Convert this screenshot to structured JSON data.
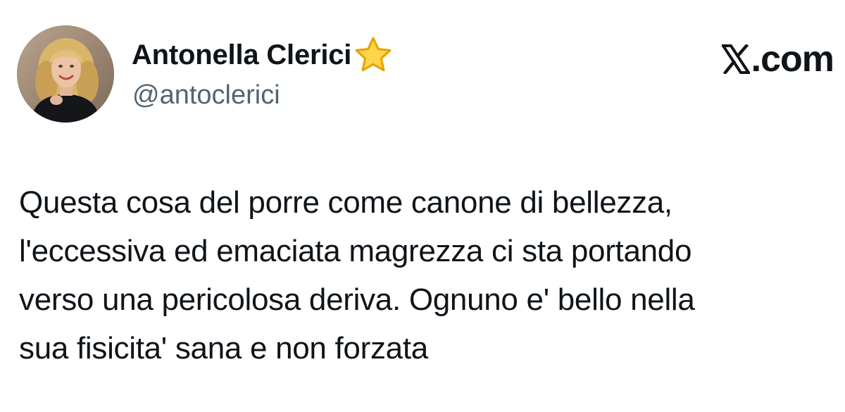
{
  "author": {
    "display_name": "Antonella Clerici",
    "badge_icon": "star-icon",
    "handle": "@antoclerici",
    "avatar_icon": "profile-photo"
  },
  "brand": {
    "logo_icon": "x-logo-icon",
    "text": ".com"
  },
  "tweet": {
    "lines": [
      "Questa cosa del porre come canone di bellezza,",
      "l'eccessiva ed emaciata magrezza ci sta portando",
      "verso una pericolosa deriva. Ognuno e' bello nella",
      "sua fisicita' sana e non forzata"
    ]
  },
  "colors": {
    "text": "#0f1419",
    "handle": "#536471",
    "background": "#ffffff",
    "star_fill": "#ffd54a",
    "star_stroke": "#e6a100"
  }
}
